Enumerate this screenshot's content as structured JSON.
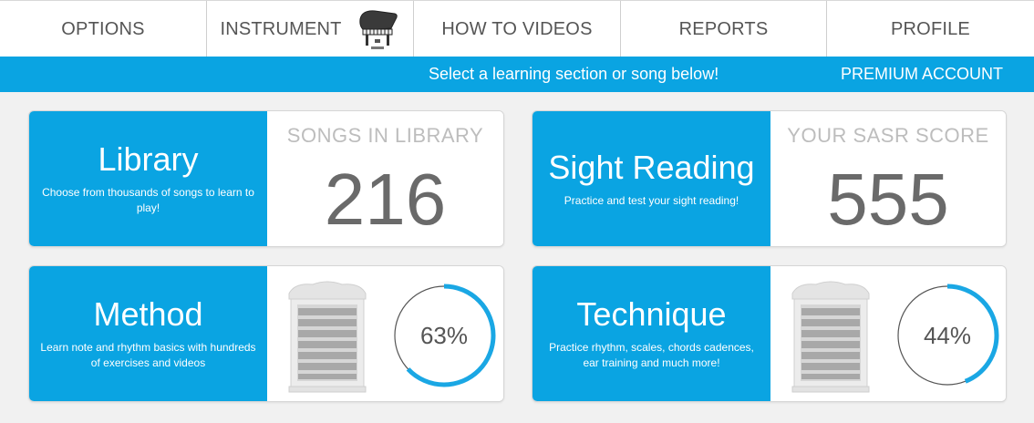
{
  "nav": {
    "tabs": [
      {
        "label": "OPTIONS"
      },
      {
        "label": "INSTRUMENT",
        "icon": "piano-icon"
      },
      {
        "label": "HOW TO VIDEOS"
      },
      {
        "label": "REPORTS"
      },
      {
        "label": "PROFILE"
      }
    ]
  },
  "banner": {
    "message": "Select a learning section or song below!",
    "account": "PREMIUM ACCOUNT"
  },
  "cards": {
    "library": {
      "title": "Library",
      "description": "Choose from thousands of songs to learn to play!",
      "stat_label": "SONGS IN LIBRARY",
      "stat_value": "216"
    },
    "sight_reading": {
      "title": "Sight Reading",
      "description": "Practice and test your sight reading!",
      "stat_label": "YOUR SASR SCORE",
      "stat_value": "555"
    },
    "method": {
      "title": "Method",
      "description": "Learn note and rhythm basics with hundreds of exercises and videos",
      "progress_label": "63%",
      "progress": 0.63,
      "icon": "cabinet-icon"
    },
    "technique": {
      "title": "Technique",
      "description": "Practice rhythm, scales, chords cadences, ear training and much more!",
      "progress_label": "44%",
      "progress": 0.44,
      "icon": "cabinet-icon"
    }
  },
  "colors": {
    "accent": "#0aa4e2",
    "progress_ring": "#1aa7e4",
    "ring_track": "#555555"
  }
}
